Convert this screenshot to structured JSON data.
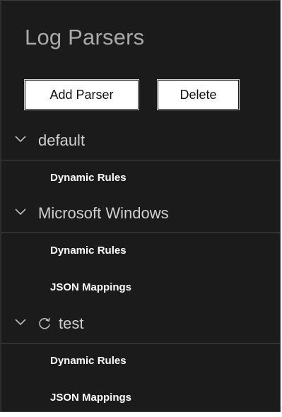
{
  "panel": {
    "title": "Log Parsers"
  },
  "toolbar": {
    "add_label": "Add Parser",
    "delete_label": "Delete"
  },
  "parsers": [
    {
      "name": "default",
      "icon": "chevron-down-icon",
      "rules": [
        "Dynamic Rules"
      ]
    },
    {
      "name": "Microsoft Windows",
      "icon": "chevron-down-icon",
      "rules": [
        "Dynamic Rules",
        "JSON Mappings"
      ]
    },
    {
      "name": "test",
      "icon": "chevron-down-icon",
      "status_icon": "sync-icon",
      "rules": [
        "Dynamic Rules",
        "JSON Mappings"
      ]
    }
  ],
  "colors": {
    "panel_bg": "#1b1b1b",
    "divider": "#4b4b4b",
    "title_text": "#a9a9a9",
    "button_bg": "#ffffff"
  }
}
